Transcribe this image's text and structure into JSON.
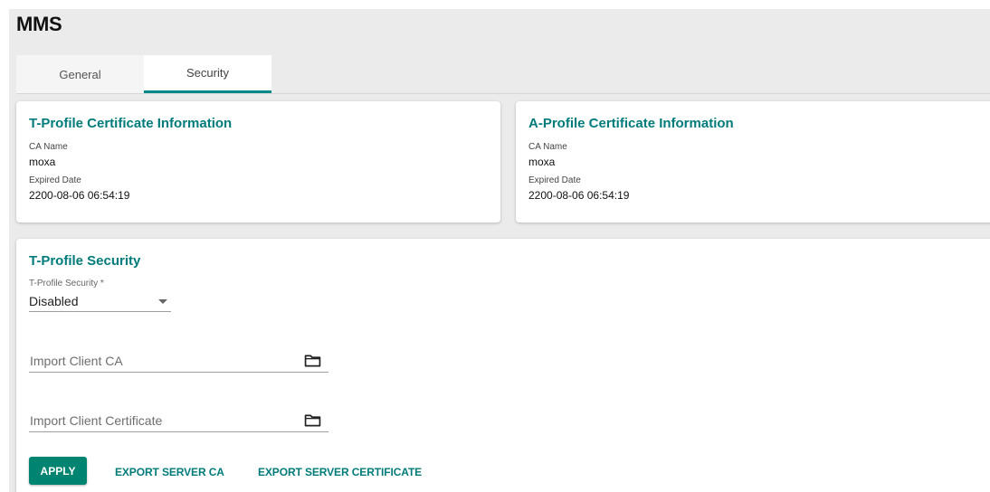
{
  "page": {
    "title": "MMS"
  },
  "tabs": [
    {
      "label": "General",
      "active": false
    },
    {
      "label": "Security",
      "active": true
    }
  ],
  "t_profile_cert": {
    "title": "T-Profile Certificate Information",
    "ca_name_label": "CA Name",
    "ca_name_value": "moxa",
    "expired_label": "Expired Date",
    "expired_value": "2200-08-06 06:54:19"
  },
  "a_profile_cert": {
    "title": "A-Profile Certificate Information",
    "ca_name_label": "CA Name",
    "ca_name_value": "moxa",
    "expired_label": "Expired Date",
    "expired_value": "2200-08-06 06:54:19"
  },
  "t_profile_security": {
    "title": "T-Profile Security",
    "security_label": "T-Profile Security *",
    "security_value": "Disabled",
    "import_client_ca_placeholder": "Import Client CA",
    "import_client_cert_placeholder": "Import Client Certificate"
  },
  "actions": {
    "apply": "APPLY",
    "export_server_ca": "EXPORT SERVER CA",
    "export_server_cert": "EXPORT SERVER CERTIFICATE"
  },
  "colors": {
    "accent": "#008787",
    "primary_button": "#008472",
    "background": "#ebebeb"
  },
  "icons": {
    "dropdown": "caret-down-icon",
    "file_picker": "folder-icon"
  }
}
